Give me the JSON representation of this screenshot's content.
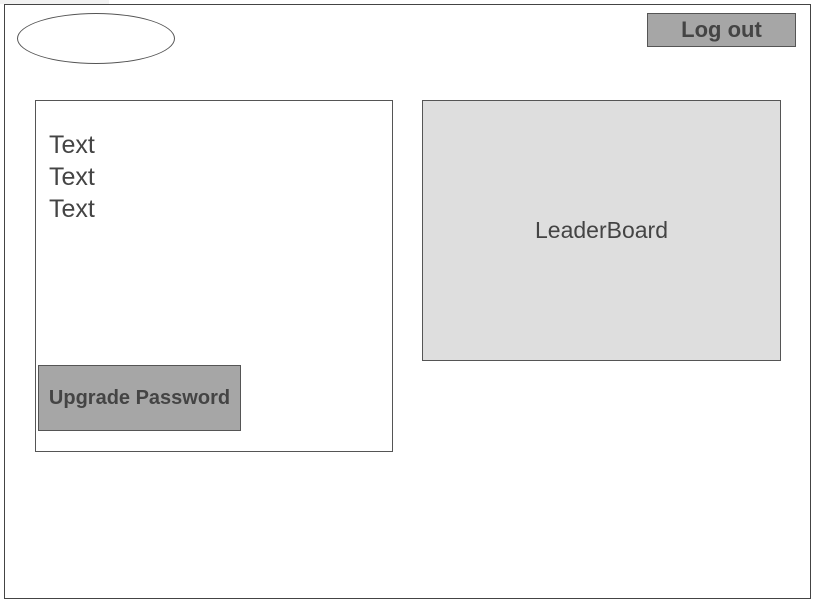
{
  "header": {
    "logo_icon": "logo-placeholder-ellipse",
    "logout_label": "Log out"
  },
  "profile": {
    "lines": [
      "Text",
      "Text",
      "Text"
    ],
    "upgrade_label": "Upgrade Password"
  },
  "leaderboard": {
    "label": "LeaderBoard"
  }
}
